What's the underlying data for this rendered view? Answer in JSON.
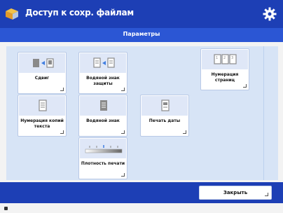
{
  "header": {
    "title": "Доступ к сохр. файлам",
    "settings_icon": "gear-icon"
  },
  "subheader": {
    "title": "Параметры"
  },
  "buttons": [
    {
      "label": "Сдвиг",
      "icon": "shift-icon"
    },
    {
      "label": "Водяной знак защиты",
      "icon": "security-watermark-icon"
    },
    {
      "label": "Нумерация страниц",
      "icon": "page-numbering-icon"
    },
    {
      "label": "Нумерация копий текста",
      "icon": "copy-numbering-icon"
    },
    {
      "label": "Водяной знак",
      "icon": "watermark-icon"
    },
    {
      "label": "Печать даты",
      "icon": "print-date-icon"
    },
    {
      "label": "Плотность печати",
      "icon": "print-density-icon"
    }
  ],
  "footer": {
    "close_label": "Закрыть"
  },
  "colors": {
    "header": "#1d3fb5",
    "subheader": "#2b56d4",
    "panel": "#d7e4f6"
  }
}
